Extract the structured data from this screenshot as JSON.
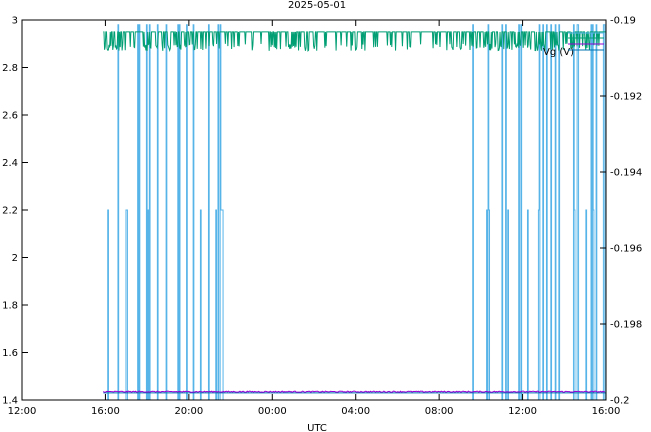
{
  "chart_data": {
    "type": "line",
    "title": "2025-05-01",
    "xlabel": "UTC",
    "x_ticks": [
      "12:00",
      "16:00",
      "20:00",
      "00:00",
      "04:00",
      "08:00",
      "12:00",
      "16:00"
    ],
    "x_range_hours": [
      0,
      28
    ],
    "y_left": {
      "range": [
        1.4,
        3.0
      ],
      "ticks": [
        "3",
        "2.8",
        "2.6",
        "2.4",
        "2.2",
        "2",
        "1.8",
        "1.6",
        "1.4"
      ]
    },
    "y_right": {
      "range": [
        -0.2,
        -0.19
      ],
      "ticks": [
        "-0.19",
        "-0.192",
        "-0.194",
        "-0.196",
        "-0.198",
        "-0.2"
      ]
    },
    "legend": {
      "position": "top-right",
      "label": "Vg (V)"
    },
    "grid": false,
    "series": [
      {
        "color": "#56b4e9",
        "axis": "left",
        "description_values": "switching between 2.98, 2.2 and 1.4",
        "segments": [
          {
            "start_h": 3.9,
            "end_h": 9.7,
            "level_pattern": [
              2.98,
              2.2,
              1.4
            ]
          },
          {
            "start_h": 21.4,
            "end_h": 28.0,
            "level_pattern": [
              2.98,
              2.2,
              1.4
            ]
          }
        ],
        "baseline": 1.4
      },
      {
        "color": "#009e73",
        "axis": "left",
        "level_high": 2.95,
        "level_low": 2.87,
        "start_h": 3.9,
        "end_h": 28.0
      },
      {
        "color": "#9400d3",
        "axis": "left",
        "level": 1.435,
        "noise": 0.005,
        "start_h": 3.9,
        "end_h": 28.0
      },
      {
        "color": "#0072b2",
        "axis": "left",
        "level": 1.43,
        "start_h": 3.9,
        "end_h": 28.0
      }
    ]
  }
}
